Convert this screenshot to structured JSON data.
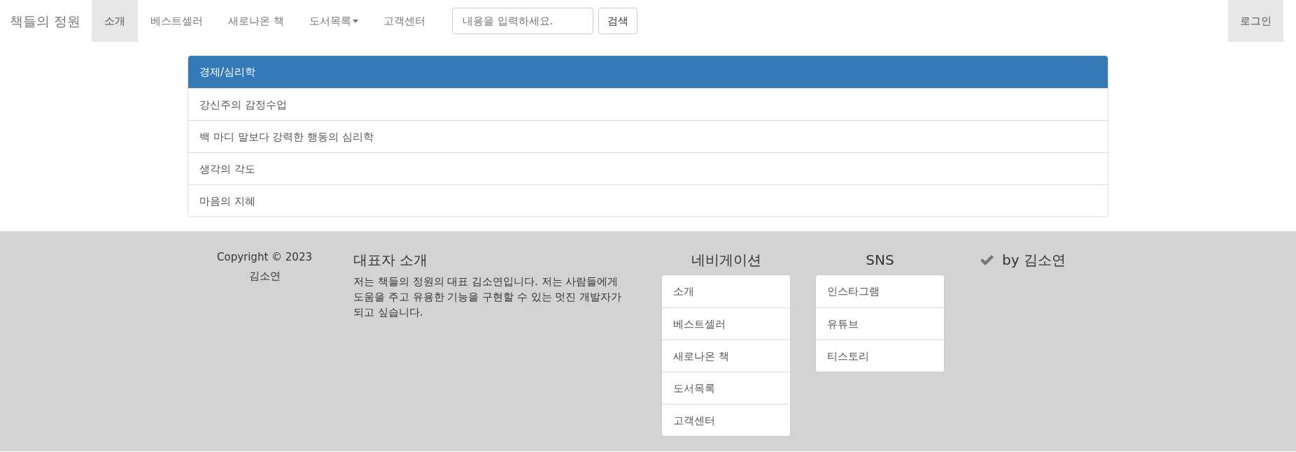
{
  "navbar": {
    "brand": "책들의 정원",
    "items": [
      {
        "label": "소개",
        "selected": true,
        "dropdown": false
      },
      {
        "label": "베스트셀러",
        "selected": false,
        "dropdown": false
      },
      {
        "label": "새로나온 책",
        "selected": false,
        "dropdown": false
      },
      {
        "label": "도서목록",
        "selected": false,
        "dropdown": true
      },
      {
        "label": "고객센터",
        "selected": false,
        "dropdown": false
      }
    ],
    "search": {
      "placeholder": "내용을 입력하세요.",
      "button": "검색"
    },
    "login": {
      "label": "로그인",
      "selected": true
    }
  },
  "panel": {
    "heading": "경제/심리학",
    "items": [
      "강신주의 감정수업",
      "백 마디 말보다 강력한 행동의 심리학",
      "생각의 각도",
      "마음의 지혜"
    ]
  },
  "footer": {
    "copyright": "Copyright © 2023",
    "author": "김소연",
    "intro": {
      "title": "대표자 소개",
      "text": "저는 책들의 정원의 대표 김소연입니다. 저는 사람들에게 도움을 주고 유용한 기능을 구현할 수 있는 멋진 개발자가 되고 싶습니다."
    },
    "navigation": {
      "title": "네비게이션",
      "items": [
        "소개",
        "베스트셀러",
        "새로나온 책",
        "도서목록",
        "고객센터"
      ]
    },
    "sns": {
      "title": "SNS",
      "items": [
        "인스타그램",
        "유튜브",
        "티스토리"
      ]
    },
    "signature": "by 김소연"
  }
}
